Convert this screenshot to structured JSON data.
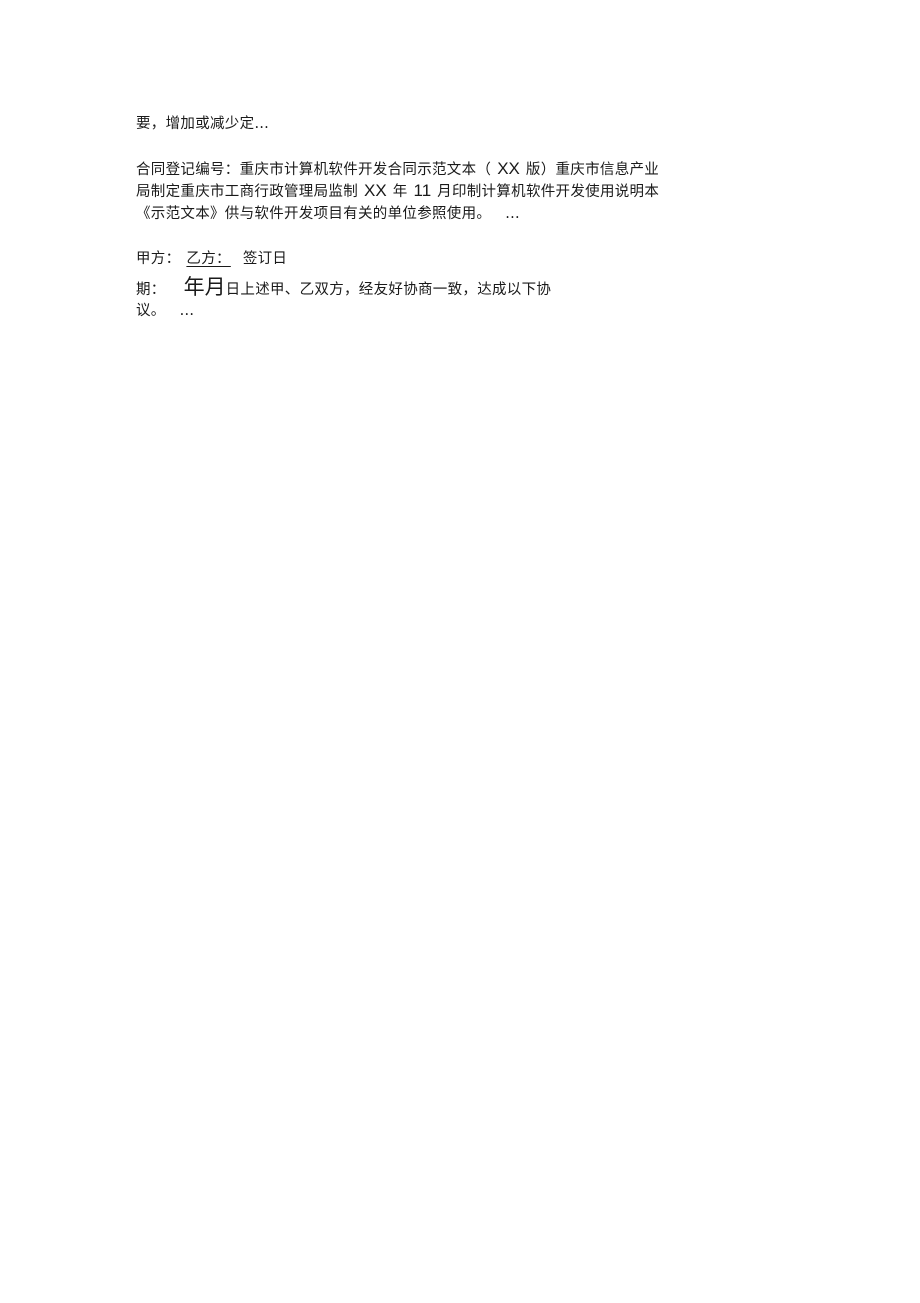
{
  "document": {
    "paragraph_1": {
      "text": "要，增加或减少定…"
    },
    "paragraph_2": {
      "line_1": {
        "pre": "合同登记编号：重庆市计算机软件开发合同示范文本（",
        "edition": "XX",
        "post": "版）重庆市信息产业"
      },
      "line_2": {
        "pre": "局制定重庆市工商行政管理局监制",
        "year": "XX",
        "year_label": "年",
        "month": "11",
        "post": "月印制计算机软件开发使用说明本"
      },
      "line_3": {
        "text": "《示范文本》供与软件开发项目有关的单位参照使用。",
        "ellipsis": "..."
      }
    },
    "paragraph_3": {
      "line_1": {
        "party_a_label": "甲方：",
        "party_b_label": "乙方：",
        "sign_date_label": "签订日"
      },
      "line_2": {
        "date_label_end": "期：",
        "year_month": "年月",
        "post": "日上述甲、乙双方，经友好协商一致，达成以下协"
      },
      "line_3": {
        "text": "议。",
        "ellipsis": "..."
      }
    }
  }
}
